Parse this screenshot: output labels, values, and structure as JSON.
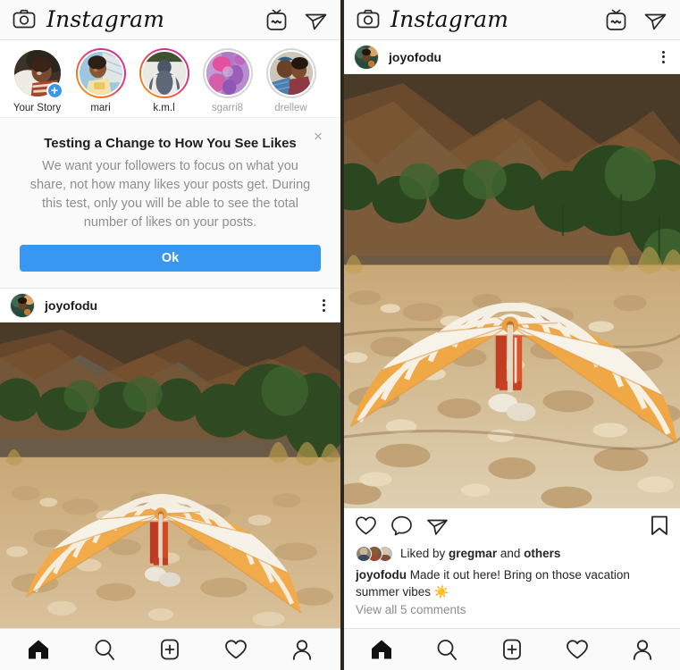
{
  "app": {
    "name": "Instagram",
    "wordmark": "Instagram"
  },
  "colors": {
    "accent_blue": "#3897f0",
    "text_primary": "#262626",
    "text_muted": "#8e8e8e",
    "header_bg": "#fafafa",
    "story_ring_unseen_start": "#f5a623",
    "story_ring_unseen_end": "#c32aa3",
    "story_ring_seen": "#d6d6d6"
  },
  "header": {
    "camera_icon": "camera-icon",
    "igtv_icon": "igtv-icon",
    "direct_icon": "direct-message-icon"
  },
  "stories": [
    {
      "name": "Your Story",
      "ring": "none",
      "muted": false,
      "has_add_badge": true
    },
    {
      "name": "mari",
      "ring": "unseen",
      "muted": false,
      "has_add_badge": false
    },
    {
      "name": "k.m.l",
      "ring": "unseen",
      "muted": false,
      "has_add_badge": false
    },
    {
      "name": "sgarri8",
      "ring": "seen",
      "muted": true,
      "has_add_badge": false
    },
    {
      "name": "drellew",
      "ring": "seen",
      "muted": true,
      "has_add_badge": false
    }
  ],
  "dialog": {
    "title": "Testing a Change to How You See Likes",
    "body": "We want your followers to focus on what you share, not how many likes your posts get. During this test, only you will be able to see the total number of likes on your posts.",
    "ok_label": "Ok",
    "close_icon": "close-icon",
    "close_label": "×"
  },
  "post": {
    "username": "joyofodu",
    "more_icon": "more-options-icon",
    "photo_alt": "Orange and white striped beach umbrella on rocky ground with person in red pants",
    "actions": {
      "like_icon": "heart-icon",
      "comment_icon": "comment-icon",
      "share_icon": "share-icon",
      "save_icon": "bookmark-icon"
    },
    "likes_prefix": "Liked by ",
    "likes_user": "gregmar",
    "likes_middle": " and ",
    "likes_others": "others",
    "caption_user": "joyofodu",
    "caption_text": " Made it out here! Bring on those vacation summer vibes ☀️",
    "view_comments": "View all 5 comments"
  },
  "tabbar": [
    {
      "name": "home",
      "icon": "home-icon",
      "active": true
    },
    {
      "name": "search",
      "icon": "search-icon",
      "active": false
    },
    {
      "name": "add",
      "icon": "add-post-icon",
      "active": false
    },
    {
      "name": "activity",
      "icon": "heart-icon",
      "active": false
    },
    {
      "name": "profile",
      "icon": "profile-icon",
      "active": false
    }
  ]
}
